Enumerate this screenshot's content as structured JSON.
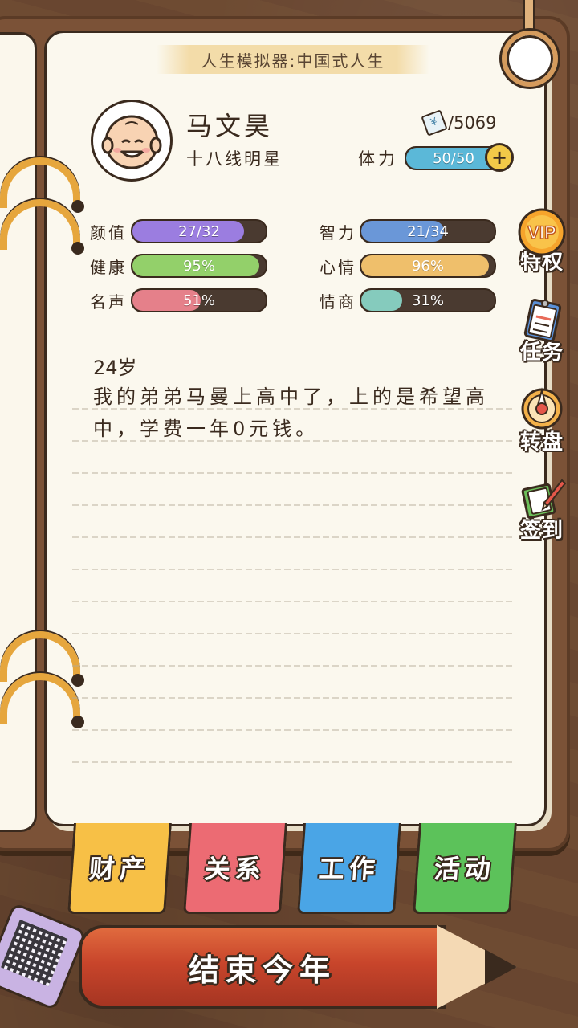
{
  "app_title": "人生模拟器:中国式人生",
  "profile": {
    "name": "马文昊",
    "rank": "十八线明星",
    "money": "5069",
    "money_prefix": "/",
    "stamina_label": "体力",
    "stamina_text": "50/50",
    "stamina_value": 1.0
  },
  "stats": [
    {
      "label": "颜值",
      "text": "27/32",
      "value": 0.84,
      "color": "#9b7de0"
    },
    {
      "label": "智力",
      "text": "21/34",
      "value": 0.62,
      "color": "#6a97d8"
    },
    {
      "label": "健康",
      "text": "95%",
      "value": 0.95,
      "color": "#93d06a"
    },
    {
      "label": "心情",
      "text": "96%",
      "value": 0.96,
      "color": "#efbf6b"
    },
    {
      "label": "名声",
      "text": "51%",
      "value": 0.51,
      "color": "#e5808a"
    },
    {
      "label": "情商",
      "text": "31%",
      "value": 0.31,
      "color": "#85cbbd"
    }
  ],
  "log": {
    "age": "24岁",
    "event": "我的弟弟马曼上高中了，上的是希望高中，学费一年0元钱。"
  },
  "side_buttons": [
    {
      "label": "特权",
      "badge": "VIP",
      "icon": "vip-icon"
    },
    {
      "label": "任务",
      "icon": "clipboard-icon"
    },
    {
      "label": "转盘",
      "icon": "wheel-icon"
    },
    {
      "label": "签到",
      "icon": "checkin-book-icon"
    }
  ],
  "tabs": [
    {
      "label": "财产",
      "color": "#f7c046"
    },
    {
      "label": "关系",
      "color": "#ec6b73"
    },
    {
      "label": "工作",
      "color": "#4aa5e6"
    },
    {
      "label": "活动",
      "color": "#5cc25a"
    }
  ],
  "end_year_label": "结束今年",
  "colors": {
    "stamina_fill": "#5bb8d8",
    "bar_track": "#4a3a30",
    "ink": "#3a2a1e"
  }
}
